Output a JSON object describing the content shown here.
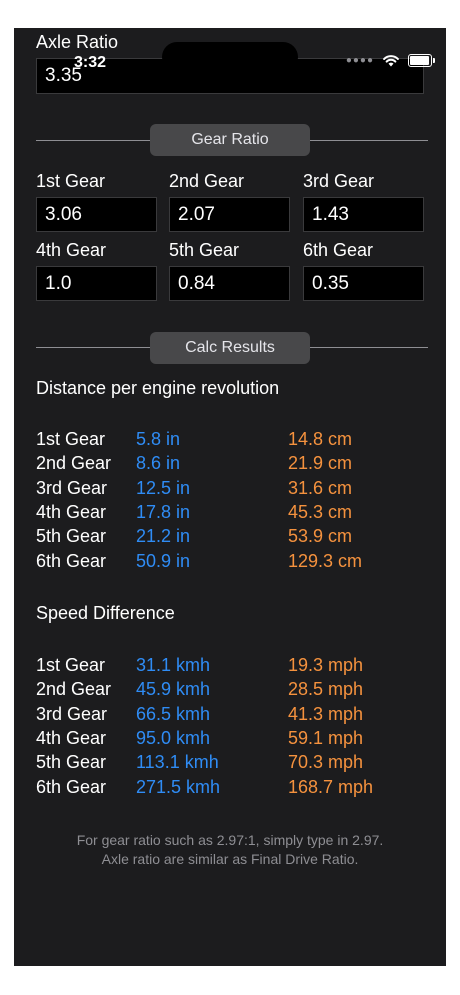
{
  "status": {
    "time": "3:32"
  },
  "axle": {
    "label": "Axle Ratio",
    "value": "3.35"
  },
  "sections": {
    "gear_ratio": "Gear Ratio",
    "calc_results": "Calc Results"
  },
  "gears": [
    {
      "label": "1st Gear",
      "value": "3.06"
    },
    {
      "label": "2nd Gear",
      "value": "2.07"
    },
    {
      "label": "3rd Gear",
      "value": "1.43"
    },
    {
      "label": "4th Gear",
      "value": "1.0"
    },
    {
      "label": "5th Gear",
      "value": "0.84"
    },
    {
      "label": "6th Gear",
      "value": "0.35"
    }
  ],
  "distance": {
    "title": "Distance per engine revolution",
    "rows": [
      {
        "gear": "1st Gear",
        "imperial": "5.8 in",
        "metric": "14.8 cm"
      },
      {
        "gear": "2nd Gear",
        "imperial": "8.6 in",
        "metric": "21.9 cm"
      },
      {
        "gear": "3rd Gear",
        "imperial": "12.5 in",
        "metric": "31.6 cm"
      },
      {
        "gear": "4th Gear",
        "imperial": "17.8 in",
        "metric": "45.3 cm"
      },
      {
        "gear": "5th Gear",
        "imperial": "21.2 in",
        "metric": "53.9 cm"
      },
      {
        "gear": "6th Gear",
        "imperial": "50.9 in",
        "metric": "129.3 cm"
      }
    ]
  },
  "speed": {
    "title": "Speed Difference",
    "rows": [
      {
        "gear": "1st Gear",
        "kmh": "31.1 kmh",
        "mph": "19.3 mph"
      },
      {
        "gear": "2nd Gear",
        "kmh": "45.9 kmh",
        "mph": "28.5 mph"
      },
      {
        "gear": "3rd Gear",
        "kmh": "66.5 kmh",
        "mph": "41.3 mph"
      },
      {
        "gear": "4th Gear",
        "kmh": "95.0 kmh",
        "mph": "59.1 mph"
      },
      {
        "gear": "5th Gear",
        "kmh": "113.1 kmh",
        "mph": "70.3 mph"
      },
      {
        "gear": "6th Gear",
        "kmh": "271.5 kmh",
        "mph": "168.7 mph"
      }
    ]
  },
  "footer": {
    "line1": "For gear ratio such as 2.97:1, simply type in 2.97.",
    "line2": "Axle ratio are similar as Final Drive Ratio."
  },
  "colors": {
    "background": "#1c1c1e",
    "blue": "#2f8cf5",
    "orange": "#f5923e"
  },
  "icons": [
    "wifi-icon",
    "battery-icon"
  ]
}
